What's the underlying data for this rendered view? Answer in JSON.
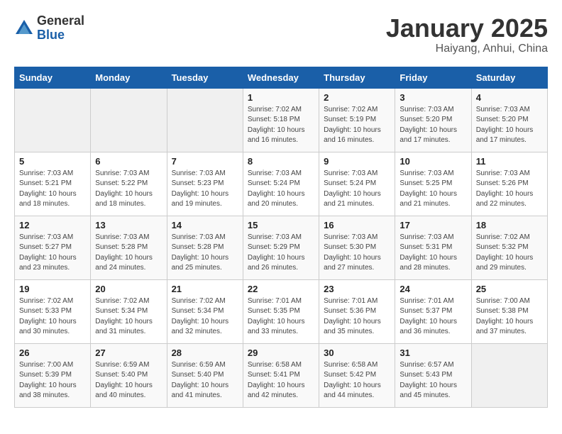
{
  "header": {
    "logo_general": "General",
    "logo_blue": "Blue",
    "title": "January 2025",
    "subtitle": "Haiyang, Anhui, China"
  },
  "days_of_week": [
    "Sunday",
    "Monday",
    "Tuesday",
    "Wednesday",
    "Thursday",
    "Friday",
    "Saturday"
  ],
  "weeks": [
    [
      {
        "day": "",
        "info": ""
      },
      {
        "day": "",
        "info": ""
      },
      {
        "day": "",
        "info": ""
      },
      {
        "day": "1",
        "info": "Sunrise: 7:02 AM\nSunset: 5:18 PM\nDaylight: 10 hours\nand 16 minutes."
      },
      {
        "day": "2",
        "info": "Sunrise: 7:02 AM\nSunset: 5:19 PM\nDaylight: 10 hours\nand 16 minutes."
      },
      {
        "day": "3",
        "info": "Sunrise: 7:03 AM\nSunset: 5:20 PM\nDaylight: 10 hours\nand 17 minutes."
      },
      {
        "day": "4",
        "info": "Sunrise: 7:03 AM\nSunset: 5:20 PM\nDaylight: 10 hours\nand 17 minutes."
      }
    ],
    [
      {
        "day": "5",
        "info": "Sunrise: 7:03 AM\nSunset: 5:21 PM\nDaylight: 10 hours\nand 18 minutes."
      },
      {
        "day": "6",
        "info": "Sunrise: 7:03 AM\nSunset: 5:22 PM\nDaylight: 10 hours\nand 18 minutes."
      },
      {
        "day": "7",
        "info": "Sunrise: 7:03 AM\nSunset: 5:23 PM\nDaylight: 10 hours\nand 19 minutes."
      },
      {
        "day": "8",
        "info": "Sunrise: 7:03 AM\nSunset: 5:24 PM\nDaylight: 10 hours\nand 20 minutes."
      },
      {
        "day": "9",
        "info": "Sunrise: 7:03 AM\nSunset: 5:24 PM\nDaylight: 10 hours\nand 21 minutes."
      },
      {
        "day": "10",
        "info": "Sunrise: 7:03 AM\nSunset: 5:25 PM\nDaylight: 10 hours\nand 21 minutes."
      },
      {
        "day": "11",
        "info": "Sunrise: 7:03 AM\nSunset: 5:26 PM\nDaylight: 10 hours\nand 22 minutes."
      }
    ],
    [
      {
        "day": "12",
        "info": "Sunrise: 7:03 AM\nSunset: 5:27 PM\nDaylight: 10 hours\nand 23 minutes."
      },
      {
        "day": "13",
        "info": "Sunrise: 7:03 AM\nSunset: 5:28 PM\nDaylight: 10 hours\nand 24 minutes."
      },
      {
        "day": "14",
        "info": "Sunrise: 7:03 AM\nSunset: 5:28 PM\nDaylight: 10 hours\nand 25 minutes."
      },
      {
        "day": "15",
        "info": "Sunrise: 7:03 AM\nSunset: 5:29 PM\nDaylight: 10 hours\nand 26 minutes."
      },
      {
        "day": "16",
        "info": "Sunrise: 7:03 AM\nSunset: 5:30 PM\nDaylight: 10 hours\nand 27 minutes."
      },
      {
        "day": "17",
        "info": "Sunrise: 7:03 AM\nSunset: 5:31 PM\nDaylight: 10 hours\nand 28 minutes."
      },
      {
        "day": "18",
        "info": "Sunrise: 7:02 AM\nSunset: 5:32 PM\nDaylight: 10 hours\nand 29 minutes."
      }
    ],
    [
      {
        "day": "19",
        "info": "Sunrise: 7:02 AM\nSunset: 5:33 PM\nDaylight: 10 hours\nand 30 minutes."
      },
      {
        "day": "20",
        "info": "Sunrise: 7:02 AM\nSunset: 5:34 PM\nDaylight: 10 hours\nand 31 minutes."
      },
      {
        "day": "21",
        "info": "Sunrise: 7:02 AM\nSunset: 5:34 PM\nDaylight: 10 hours\nand 32 minutes."
      },
      {
        "day": "22",
        "info": "Sunrise: 7:01 AM\nSunset: 5:35 PM\nDaylight: 10 hours\nand 33 minutes."
      },
      {
        "day": "23",
        "info": "Sunrise: 7:01 AM\nSunset: 5:36 PM\nDaylight: 10 hours\nand 35 minutes."
      },
      {
        "day": "24",
        "info": "Sunrise: 7:01 AM\nSunset: 5:37 PM\nDaylight: 10 hours\nand 36 minutes."
      },
      {
        "day": "25",
        "info": "Sunrise: 7:00 AM\nSunset: 5:38 PM\nDaylight: 10 hours\nand 37 minutes."
      }
    ],
    [
      {
        "day": "26",
        "info": "Sunrise: 7:00 AM\nSunset: 5:39 PM\nDaylight: 10 hours\nand 38 minutes."
      },
      {
        "day": "27",
        "info": "Sunrise: 6:59 AM\nSunset: 5:40 PM\nDaylight: 10 hours\nand 40 minutes."
      },
      {
        "day": "28",
        "info": "Sunrise: 6:59 AM\nSunset: 5:40 PM\nDaylight: 10 hours\nand 41 minutes."
      },
      {
        "day": "29",
        "info": "Sunrise: 6:58 AM\nSunset: 5:41 PM\nDaylight: 10 hours\nand 42 minutes."
      },
      {
        "day": "30",
        "info": "Sunrise: 6:58 AM\nSunset: 5:42 PM\nDaylight: 10 hours\nand 44 minutes."
      },
      {
        "day": "31",
        "info": "Sunrise: 6:57 AM\nSunset: 5:43 PM\nDaylight: 10 hours\nand 45 minutes."
      },
      {
        "day": "",
        "info": ""
      }
    ]
  ]
}
